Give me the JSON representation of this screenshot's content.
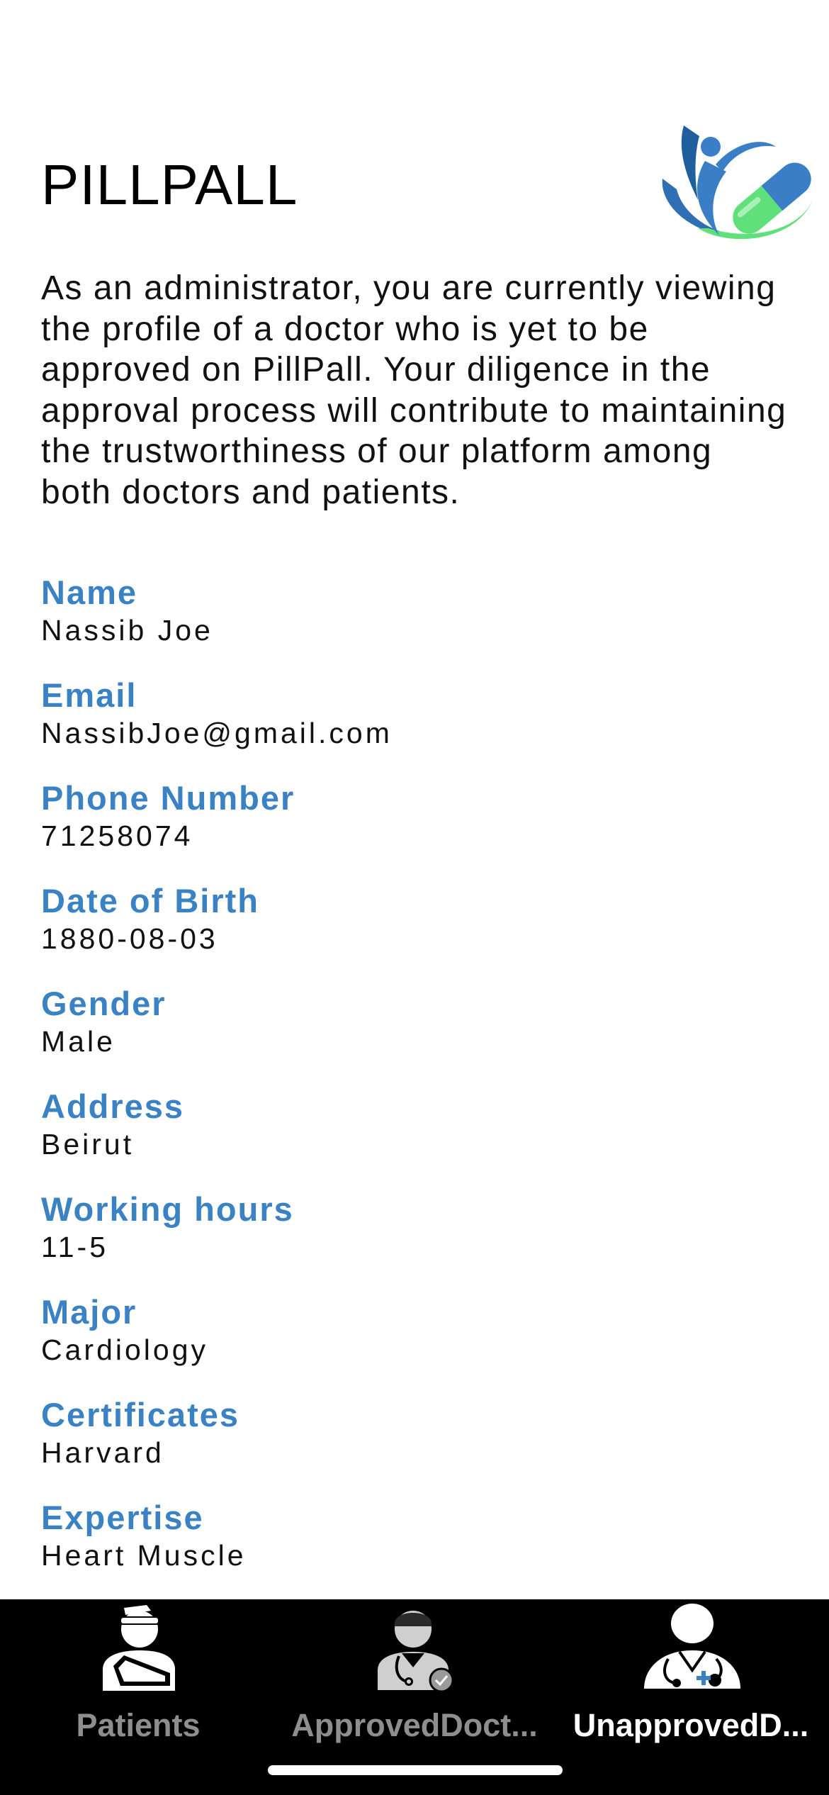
{
  "header": {
    "title": "PILLPALL",
    "logo_icon": "pillpall-logo-icon"
  },
  "intro": {
    "text": "As an administrator, you are currently viewing the profile of a doctor who is yet to be approved on PillPall. Your diligence in the approval process will contribute to maintaining the trustworthiness of our platform among both doctors and patients."
  },
  "profile": {
    "fields": [
      {
        "label": "Name",
        "value": "Nassib Joe"
      },
      {
        "label": "Email",
        "value": "NassibJoe@gmail.com"
      },
      {
        "label": "Phone Number",
        "value": "71258074"
      },
      {
        "label": "Date of Birth",
        "value": "1880-08-03"
      },
      {
        "label": "Gender",
        "value": "Male"
      },
      {
        "label": "Address",
        "value": "Beirut"
      },
      {
        "label": "Working hours",
        "value": "11-5"
      },
      {
        "label": "Major",
        "value": "Cardiology"
      },
      {
        "label": "Certificates",
        "value": "Harvard"
      },
      {
        "label": "Expertise",
        "value": "Heart Muscle"
      }
    ]
  },
  "tabbar": {
    "tabs": [
      {
        "label": "Patients",
        "icon": "patient-icon",
        "active": false
      },
      {
        "label": "ApprovedDoct...",
        "icon": "approved-doctor-icon",
        "active": false
      },
      {
        "label": "UnapprovedD...",
        "icon": "unapproved-doctor-icon",
        "active": true
      }
    ]
  },
  "colors": {
    "accent": "#3a82c4",
    "logo_blue": "#3a7fc6",
    "logo_green": "#5fe07a",
    "tabbar_bg": "#000000",
    "tab_inactive": "#8e8e8e",
    "tab_active": "#ffffff"
  }
}
